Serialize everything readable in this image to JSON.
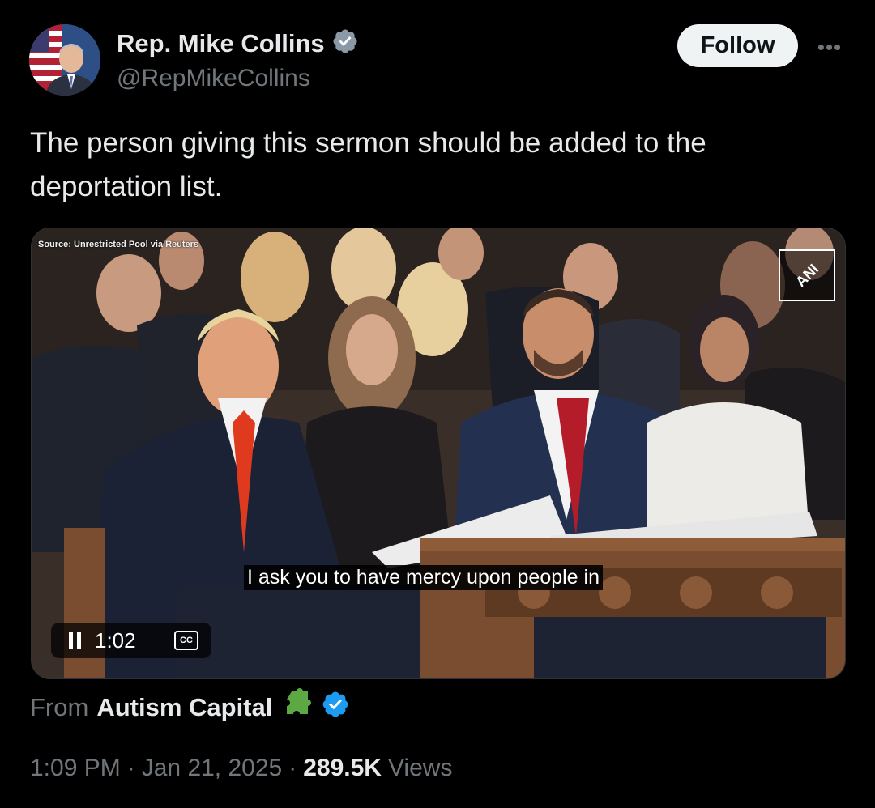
{
  "author": {
    "name": "Rep. Mike Collins",
    "handle": "@RepMikeCollins",
    "verified_badge_color": "#8b98a5"
  },
  "follow_button": {
    "label": "Follow"
  },
  "more_menu": {
    "icon": "more-horizontal-icon",
    "label": "•••"
  },
  "tweet": {
    "text": "The person giving this sermon should be added to the deportation list."
  },
  "video": {
    "source_label": "Source: Unrestricted Pool via Reuters",
    "watermark": "ANI",
    "caption": "I ask you to have mercy upon people in",
    "time": "1:02",
    "cc_label": "CC"
  },
  "attribution": {
    "from_label": "From",
    "account_name": "Autism Capital",
    "emoji": "puzzle-piece",
    "verified_badge_color": "#1d9bf0"
  },
  "meta": {
    "time": "1:09 PM",
    "separator": "·",
    "date": "Jan 21, 2025",
    "views_count": "289.5K",
    "views_label": "Views"
  },
  "colors": {
    "background": "#000000",
    "primary_text": "#e7e9ea",
    "secondary_text": "#71767b",
    "accent_blue": "#1d9bf0"
  }
}
